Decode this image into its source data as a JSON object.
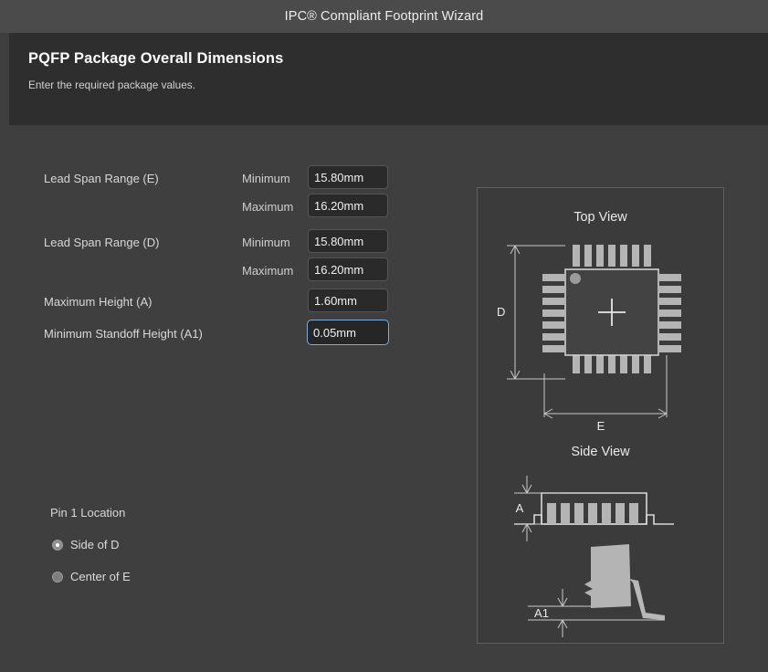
{
  "window": {
    "title": "IPC® Compliant Footprint Wizard"
  },
  "header": {
    "title": "PQFP Package Overall Dimensions",
    "subtitle": "Enter the required package values."
  },
  "form": {
    "rows": [
      {
        "label": "Lead Span Range (E)",
        "min_label": "Minimum",
        "min_value": "15.80mm",
        "max_label": "Maximum",
        "max_value": "16.20mm"
      },
      {
        "label": "Lead Span Range (D)",
        "min_label": "Minimum",
        "min_value": "15.80mm",
        "max_label": "Maximum",
        "max_value": "16.20mm"
      }
    ],
    "height_label": "Maximum Height (A)",
    "height_value": "1.60mm",
    "standoff_label": "Minimum Standoff Height (A1)",
    "standoff_value": "0.05mm",
    "standoff_focused": true
  },
  "pin1": {
    "group_label": "Pin 1 Location",
    "options": [
      {
        "label": "Side of D",
        "selected": true
      },
      {
        "label": "Center of E",
        "selected": false
      }
    ]
  },
  "diagram": {
    "top_view_caption": "Top View",
    "side_view_caption": "Side View",
    "dim_d": "D",
    "dim_e": "E",
    "dim_a": "A",
    "dim_a1": "A1"
  },
  "colors": {
    "titlebar_bg": "#4b4b4b",
    "header_bg": "#2e2e2e",
    "body_bg": "#3f3f3f",
    "field_bg": "#2a2a2a",
    "focus_border": "#7aaede",
    "lead_fill": "#b4b4b4",
    "line": "#dcdcdc"
  }
}
